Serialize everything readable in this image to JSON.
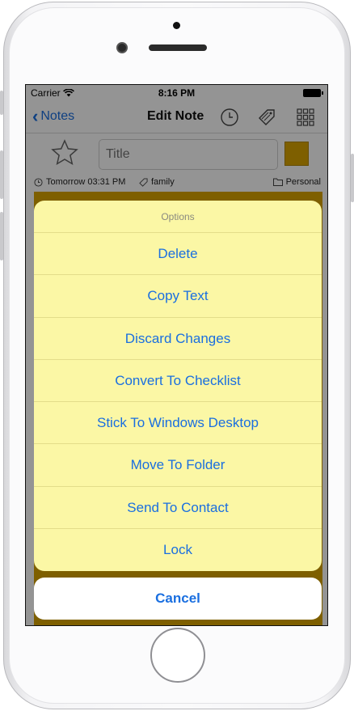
{
  "status_bar": {
    "carrier": "Carrier",
    "time": "8:16 PM"
  },
  "nav": {
    "back_label": "Notes",
    "title": "Edit Note"
  },
  "note": {
    "title_placeholder": "Title",
    "reminder": "Tomorrow 03:31 PM",
    "tag": "family",
    "folder": "Personal",
    "color": "#d9a400"
  },
  "action_sheet": {
    "title": "Options",
    "items": [
      "Delete",
      "Copy Text",
      "Discard Changes",
      "Convert To Checklist",
      "Stick To Windows Desktop",
      "Move To Folder",
      "Send To Contact",
      "Lock"
    ],
    "cancel": "Cancel"
  }
}
